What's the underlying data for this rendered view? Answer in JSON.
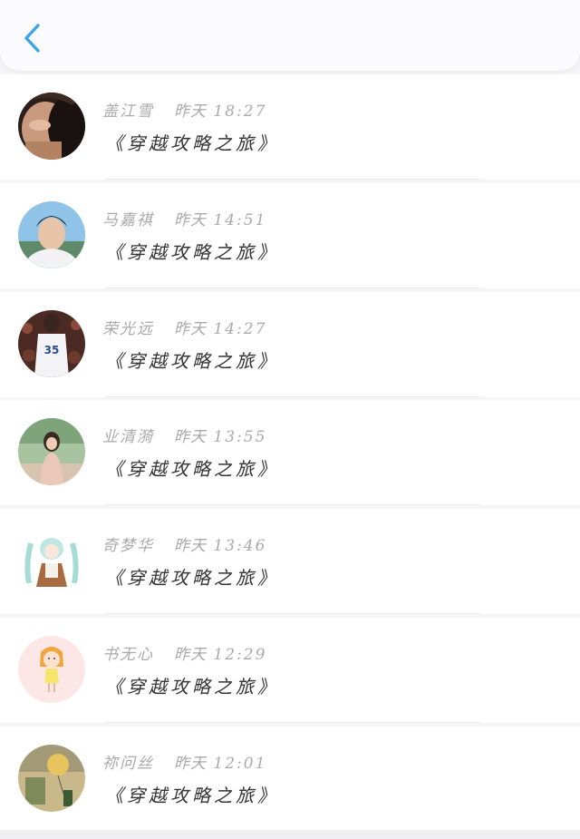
{
  "header": {
    "back_icon": "chevron-left-icon",
    "accent_color": "#3ea4e8"
  },
  "items": [
    {
      "name": "盖江雪",
      "date": "昨天",
      "time": "18:27",
      "message": "《穿越攻略之旅》",
      "avatar": "photo-portrait-woman"
    },
    {
      "name": "马嘉祺",
      "date": "昨天",
      "time": "14:51",
      "message": "《穿越攻略之旅》",
      "avatar": "photo-portrait-man"
    },
    {
      "name": "荣光远",
      "date": "昨天",
      "time": "14:27",
      "message": "《穿越攻略之旅》",
      "avatar": "photo-basketball-player"
    },
    {
      "name": "业清漪",
      "date": "昨天",
      "time": "13:55",
      "message": "《穿越攻略之旅》",
      "avatar": "photo-girl-outdoor"
    },
    {
      "name": "奇梦华",
      "date": "昨天",
      "time": "13:46",
      "message": "《穿越攻略之旅》",
      "avatar": "anime-character"
    },
    {
      "name": "书无心",
      "date": "昨天",
      "time": "12:29",
      "message": "《穿越攻略之旅》",
      "avatar": "cartoon-girl"
    },
    {
      "name": "祢问丝",
      "date": "昨天",
      "time": "12:01",
      "message": "《穿越攻略之旅》",
      "avatar": "photo-balloon-scene"
    }
  ]
}
